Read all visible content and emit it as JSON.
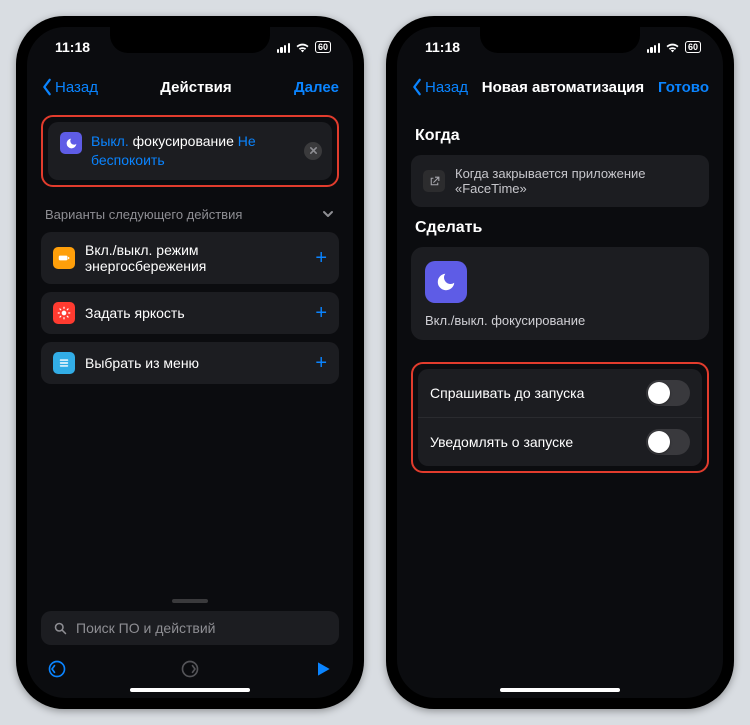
{
  "left": {
    "status": {
      "time": "11:18",
      "battery": "60"
    },
    "nav": {
      "back": "Назад",
      "title": "Действия",
      "next": "Далее"
    },
    "action_card": {
      "off": "Выкл.",
      "main": "фокусирование",
      "dnd": "Не беспокоить"
    },
    "suggest_header": "Варианты следующего действия",
    "suggestions": [
      {
        "label": "Вкл./выкл. режим энергосбережения",
        "color": "#ff9f0a"
      },
      {
        "label": "Задать яркость",
        "color": "#ff3b30"
      },
      {
        "label": "Выбрать из меню",
        "color": "#32ade6"
      }
    ],
    "search_placeholder": "Поиск ПО и действий"
  },
  "right": {
    "status": {
      "time": "11:18",
      "battery": "60"
    },
    "nav": {
      "back": "Назад",
      "title": "Новая автоматизация",
      "done": "Готово"
    },
    "when_title": "Когда",
    "when_text": "Когда закрывается приложение «FaceTime»",
    "do_title": "Сделать",
    "do_label": "Вкл./выкл. фокусирование",
    "toggles": {
      "ask": "Спрашивать до запуска",
      "notify": "Уведомлять о запуске"
    }
  }
}
